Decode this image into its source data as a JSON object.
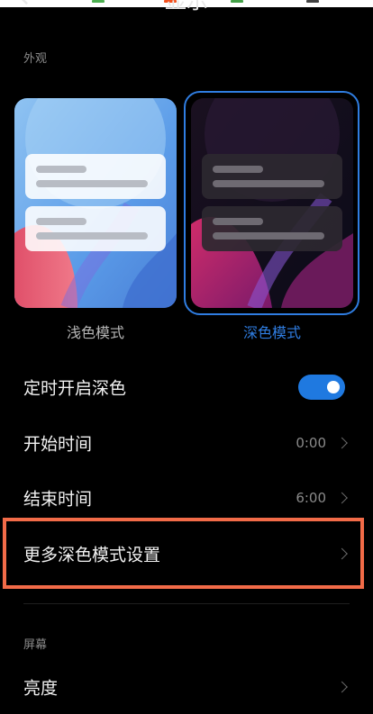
{
  "colors": {
    "accent": "#2f7de1",
    "toggle_on": "#1f79e0",
    "highlight": "#f26b48"
  },
  "header": {
    "title": "显示",
    "back_icon": "arrow-left-icon"
  },
  "appearance": {
    "section_label": "外观",
    "light_mode_label": "浅色模式",
    "dark_mode_label": "深色模式",
    "selected": "深色模式"
  },
  "settings": {
    "scheduled_dark": {
      "label": "定时开启深色",
      "enabled": true
    },
    "start_time": {
      "label": "开始时间",
      "value": "0:00"
    },
    "end_time": {
      "label": "结束时间",
      "value": "6:00"
    },
    "more_dark": {
      "label": "更多深色模式设置"
    }
  },
  "screen": {
    "section_label": "屏幕",
    "brightness": {
      "label": "亮度"
    }
  }
}
